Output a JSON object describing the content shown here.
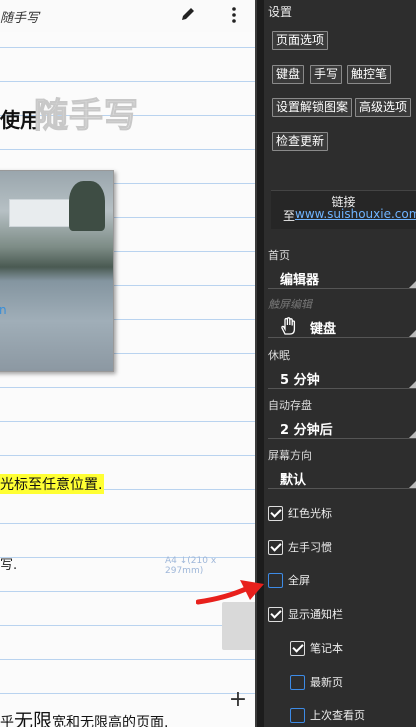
{
  "editor": {
    "app_title": "随手写",
    "line_use": "使用",
    "logo": "随手写",
    "photo_tag": "n",
    "highlight_line": "光标至任意位置.",
    "hand_line": "写.",
    "a4_label": "A4 ↓(210 x 297mm)",
    "bottom_pre": "乎",
    "bottom_big": "无限",
    "bottom_post": "宽和无限高的页面.",
    "add_label": "+"
  },
  "settings": {
    "title": "设置",
    "buttons": {
      "page_options": "页面选项",
      "keyboard": "键盘",
      "handwrite": "手写",
      "touchpad": "触控笔",
      "unlock_pattern": "设置解锁图案",
      "advanced": "高级选项",
      "check_update": "检查更新"
    },
    "link": {
      "title": "链接",
      "prefix": "至",
      "url": "www.suishouxie.com"
    },
    "home": {
      "label": "首页",
      "value": "编辑器"
    },
    "touch_edit": {
      "label": "触屏编辑",
      "value": "键盘"
    },
    "sleep": {
      "label": "休眠",
      "value": "5 分钟"
    },
    "autosave": {
      "label": "自动存盘",
      "value": "2 分钟后"
    },
    "orientation": {
      "label": "屏幕方向",
      "value": "默认"
    },
    "checks": [
      {
        "label": "红色光标",
        "checked": true
      },
      {
        "label": "左手习惯",
        "checked": true
      },
      {
        "label": "全屏",
        "checked": false
      },
      {
        "label": "显示通知栏",
        "checked": true
      },
      {
        "label": "笔记本",
        "checked": true
      },
      {
        "label": "最新页",
        "checked": false
      },
      {
        "label": "上次查看页",
        "checked": false
      }
    ]
  },
  "colors": {
    "accent_link": "#6fb4ff",
    "arrow": "#e8201c",
    "highlight": "#ffff33"
  }
}
